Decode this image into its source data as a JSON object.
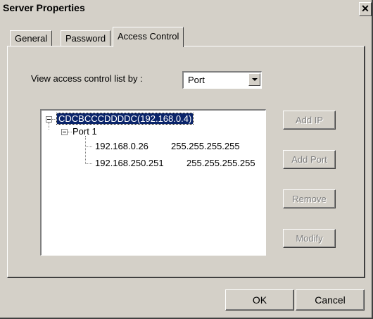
{
  "window": {
    "title": "Server Properties",
    "close_glyph": "✕"
  },
  "tabs": [
    {
      "label": "General",
      "active": false
    },
    {
      "label": "Password",
      "active": false
    },
    {
      "label": "Access Control",
      "active": true
    }
  ],
  "access_control": {
    "view_label": "View access control list by :",
    "view_by_value": "Port",
    "tree": {
      "root": "CDCBCCCDDDDC(192.168.0.4)",
      "port": "Port 1",
      "entries": [
        {
          "ip": "192.168.0.26",
          "mask": "255.255.255.255"
        },
        {
          "ip": "192.168.250.251",
          "mask": "255.255.255.255"
        }
      ]
    },
    "buttons": {
      "add_ip": "Add IP",
      "add_port": "Add Port",
      "remove": "Remove",
      "modify": "Modify"
    }
  },
  "footer": {
    "ok": "OK",
    "cancel": "Cancel"
  }
}
